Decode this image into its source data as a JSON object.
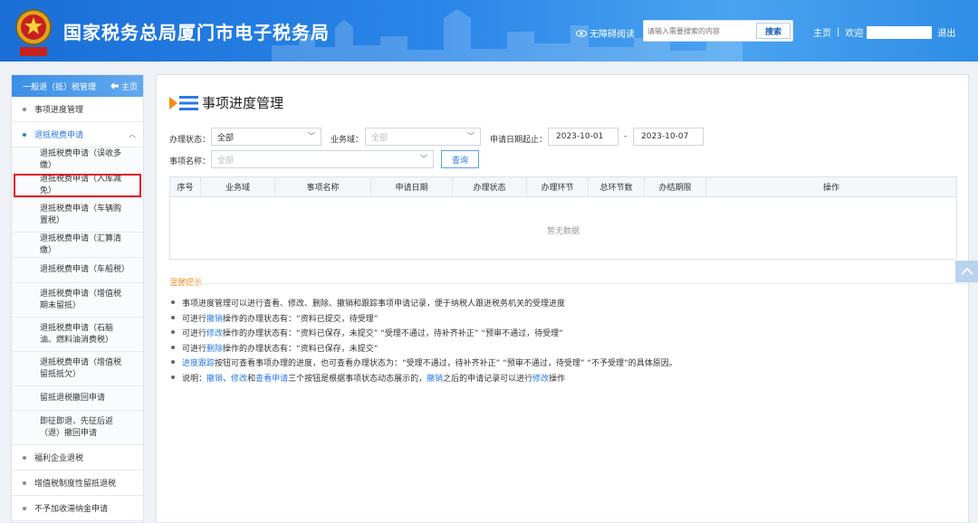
{
  "header": {
    "title": "国家税务总局厦门市电子税务局",
    "logo_text": "中国税务",
    "accessibility": "无障碍阅读",
    "search_placeholder": "请输入需要搜索的内容",
    "search_button": "搜索",
    "home": "主页",
    "welcome": "欢迎",
    "logout": "退出",
    "colors": {
      "gradient_start": "#1a6ed6",
      "gradient_end": "#4aa3f0"
    }
  },
  "sidebar": {
    "header": "一般退（抵）税管理",
    "home_link": "主页",
    "items": [
      {
        "label": "事项进度管理"
      },
      {
        "label": "退抵税费申请"
      }
    ],
    "sub_items": [
      {
        "label": "退抵税费申请（误收多缴）"
      },
      {
        "label": "退抵税费申请（入库减免）"
      },
      {
        "label": "退抵税费申请（车辆购置税）"
      },
      {
        "label": "退抵税费申请（汇算清缴）"
      },
      {
        "label": "退抵税费申请（车船税）"
      },
      {
        "label": "退抵税费申请（增值税期末留抵）"
      },
      {
        "label": "退抵税费申请（石脑油、燃料油消费税）"
      },
      {
        "label": "退抵税费申请（增值税留抵抵欠）"
      },
      {
        "label": "留抵退税撤回申请"
      },
      {
        "label": "即征即退、先征后返（退）撤回申请"
      }
    ],
    "bottom_items": [
      {
        "label": "福利企业退税"
      },
      {
        "label": "增值税制度性留抵退税"
      },
      {
        "label": "不予加收滞纳金申请"
      }
    ]
  },
  "main": {
    "title": "事项进度管理",
    "form": {
      "status_label": "办理状态：",
      "status_value": "全部",
      "domain_label": "业务域：",
      "domain_value": "全部",
      "date_label": "申请日期起止：",
      "date_start": "2023-10-01",
      "date_sep": "-",
      "date_end": "2023-10-07",
      "item_label": "事项名称：",
      "item_value": "全部",
      "query_button": "查询"
    },
    "table": {
      "columns": [
        "序号",
        "业务域",
        "事项名称",
        "申请日期",
        "办理状态",
        "办理环节",
        "总环节数",
        "办结期限",
        "操作"
      ],
      "empty_text": "暂无数据"
    },
    "tips": {
      "title": "温馨提示",
      "t1": "事项进度管理可以进行查看、修改、删除、撤销和跟踪事项申请记录，便于纳税人跟进税务机关的受理进度",
      "t2a": "可进行",
      "t2b": "撤销",
      "t2c": "操作的办理状态有：“资料已提交，待受理”",
      "t3a": "可进行",
      "t3b": "修改",
      "t3c": "操作的办理状态有：“资料已保存，未提交” “受理不通过，待补齐补正” “预审不通过，待受理”",
      "t4a": "可进行",
      "t4b": "删除",
      "t4c": "操作的办理状态有：“资料已保存，未提交”",
      "t5a": "进度跟踪",
      "t5b": "按钮可查看事项办理的进度，也可查看办理状态为：“受理不通过，待补齐补正” “预审不通过，待受理” “不予受理”的具体原因。",
      "t6a": "说明：",
      "t6b": "撤销",
      "t6c": "、",
      "t6d": "修改",
      "t6e": "和",
      "t6f": "查看申请",
      "t6g": "三个按钮是根据事项状态动态展示的，",
      "t6h": "撤销",
      "t6i": "之后的申请记录可以进行",
      "t6j": "修改",
      "t6k": "操作"
    }
  }
}
